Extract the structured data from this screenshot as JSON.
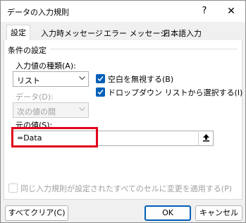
{
  "window": {
    "title": "データの入力規則",
    "help_label": "?",
    "close_label": "✕"
  },
  "tabs": [
    {
      "label": "設定",
      "active": true
    },
    {
      "label": "入力時メッセージ",
      "active": false
    },
    {
      "label": "エラー メッセージ",
      "active": false
    },
    {
      "label": "日本語入力",
      "active": false
    }
  ],
  "settings": {
    "group_label": "条件の設定",
    "allow_label": "入力値の種類(A):",
    "allow_value": "リスト",
    "data_label": "データ(D):",
    "data_value": "次の値の間",
    "ignore_blank": {
      "label": "空白を無視する(B)",
      "checked": true
    },
    "in_cell_dropdown": {
      "label": "ドロップダウン リストから選択する(I)",
      "checked": true
    },
    "source_label": "元の値(S):",
    "source_value": "=Data",
    "apply_all": {
      "label": "同じ入力規則が設定されたすべてのセルに変更を適用する(P)",
      "checked": false
    }
  },
  "buttons": {
    "clear_all": "すべてクリア(C)",
    "ok": "OK",
    "cancel": "キャンセル"
  },
  "colors": {
    "accent": "#005fb8",
    "highlight": "#e0001b"
  },
  "icons": {
    "close": "close-icon",
    "help": "help-icon",
    "collapse": "collapse-dialog-icon",
    "dropdown": "chevron-down-icon",
    "check": "checkmark-icon"
  }
}
